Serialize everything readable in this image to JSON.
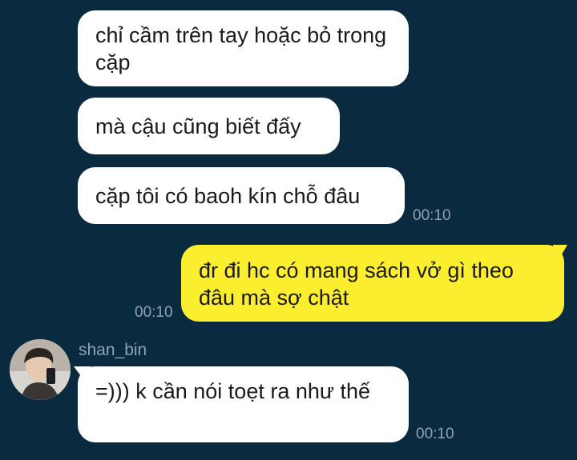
{
  "messages": [
    {
      "text": "chỉ cầm trên tay hoặc bỏ trong cặp",
      "direction": "incoming"
    },
    {
      "text": "mà cậu cũng biết đấy",
      "direction": "incoming"
    },
    {
      "text": "cặp tôi có baoh kín chỗ đâu",
      "direction": "incoming",
      "time": "00:10"
    },
    {
      "text": "đr đi hc có mang sách vở gì theo đâu mà sợ chật",
      "direction": "outgoing",
      "time": "00:10"
    },
    {
      "text": "=))) k cần nói toẹt ra như thế",
      "direction": "incoming",
      "sender": "shan_bin",
      "time": "00:10"
    }
  ],
  "colors": {
    "background": "#0a2a3f",
    "incoming_bubble": "#ffffff",
    "outgoing_bubble": "#fbee2e",
    "meta_text": "#8fa3b3"
  }
}
